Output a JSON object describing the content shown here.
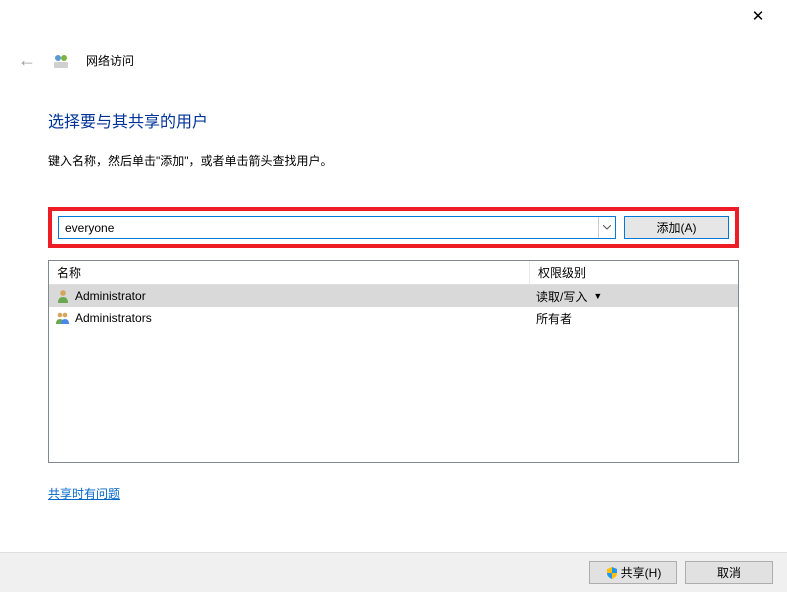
{
  "window": {
    "title": "网络访问"
  },
  "page": {
    "heading": "选择要与其共享的用户",
    "subtext": "键入名称，然后单击\"添加\"，或者单击箭头查找用户。"
  },
  "input": {
    "value": "everyone",
    "add_label": "添加(A)"
  },
  "table": {
    "col_name": "名称",
    "col_perm": "权限级别",
    "rows": [
      {
        "name": "Administrator",
        "perm": "读取/写入",
        "has_dropdown": true,
        "icon": "single"
      },
      {
        "name": "Administrators",
        "perm": "所有者",
        "has_dropdown": false,
        "icon": "group"
      }
    ]
  },
  "help_link": "共享时有问题",
  "footer": {
    "share_label": "共享(H)",
    "cancel_label": "取消"
  }
}
